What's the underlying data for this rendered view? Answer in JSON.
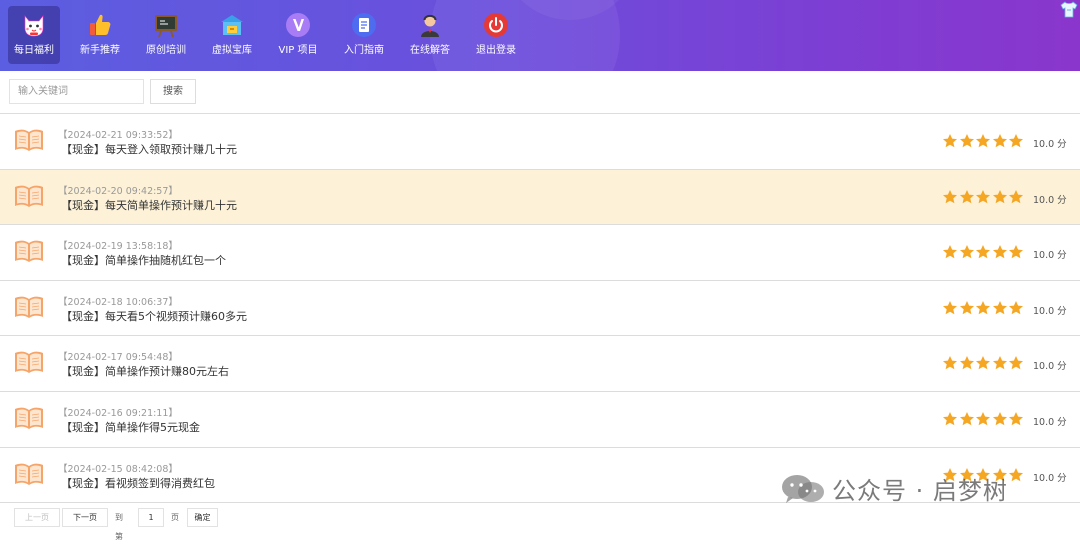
{
  "nav": {
    "items": [
      {
        "label": "每日福利",
        "icon": "lucky-cat-icon",
        "active": true
      },
      {
        "label": "新手推荐",
        "icon": "thumbs-up-icon"
      },
      {
        "label": "原创培训",
        "icon": "blackboard-icon"
      },
      {
        "label": "虚拟宝库",
        "icon": "treasure-house-icon"
      },
      {
        "label": "VIP 项目",
        "icon": "vip-icon"
      },
      {
        "label": "入门指南",
        "icon": "document-icon"
      },
      {
        "label": "在线解答",
        "icon": "support-agent-icon"
      },
      {
        "label": "退出登录",
        "icon": "power-icon"
      }
    ]
  },
  "search": {
    "placeholder": "输入关键词",
    "button_label": "搜索"
  },
  "list": {
    "rows": [
      {
        "date": "【2024-02-21 09:33:52】",
        "title": "【现金】每天登入领取预计赚几十元",
        "rating": 5,
        "score": "10.0 分"
      },
      {
        "date": "【2024-02-20 09:42:57】",
        "title": "【现金】每天简单操作预计赚几十元",
        "rating": 5,
        "score": "10.0 分"
      },
      {
        "date": "【2024-02-19 13:58:18】",
        "title": "【现金】简单操作抽随机红包一个",
        "rating": 5,
        "score": "10.0 分"
      },
      {
        "date": "【2024-02-18 10:06:37】",
        "title": "【现金】每天看5个视频预计赚60多元",
        "rating": 5,
        "score": "10.0 分"
      },
      {
        "date": "【2024-02-17 09:54:48】",
        "title": "【现金】简单操作预计赚80元左右",
        "rating": 5,
        "score": "10.0 分"
      },
      {
        "date": "【2024-02-16 09:21:11】",
        "title": "【现金】简单操作得5元现金",
        "rating": 5,
        "score": "10.0 分"
      },
      {
        "date": "【2024-02-15 08:42:08】",
        "title": "【现金】看视频签到得消费红包",
        "rating": 5,
        "score": "10.0 分"
      }
    ]
  },
  "pagination": {
    "prev_label": "上一页",
    "next_label": "下一页",
    "goto_label": "到第",
    "page_value": "1",
    "page_unit": "页",
    "confirm_label": "确定"
  },
  "watermark": {
    "text": "公众号 · 启梦树"
  },
  "colors": {
    "nav_gradient_start": "#5b5ee0",
    "nav_gradient_end": "#8a36cc",
    "highlight_row": "#fdf2d8",
    "star": "#f5a623"
  }
}
